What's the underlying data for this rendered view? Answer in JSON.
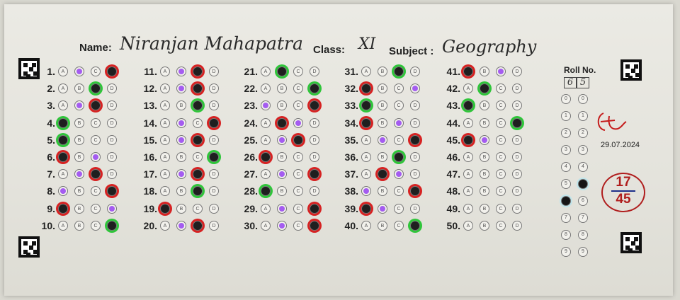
{
  "header": {
    "name_label": "Name:",
    "name_value": "Niranjan Mahapatra",
    "class_label": "Class:",
    "class_value": "XI",
    "subject_label": "Subject :",
    "subject_value": "Geography"
  },
  "roll": {
    "label": "Roll No.",
    "digits": [
      "6",
      "5"
    ]
  },
  "date": "29.07.2024",
  "score": {
    "obtained": "17",
    "total": "45"
  },
  "colors": {
    "wrong": "#d62222",
    "correct": "#2fc53a",
    "marked": "#a45cf0",
    "filled": "#1f1f1f"
  },
  "questions": [
    {
      "n": "1.",
      "m": "B",
      "f": "D",
      "c": "red"
    },
    {
      "n": "2.",
      "m": "",
      "f": "C",
      "c": "green"
    },
    {
      "n": "3.",
      "m": "B",
      "f": "C",
      "c": "red"
    },
    {
      "n": "4.",
      "m": "",
      "f": "A",
      "c": "green"
    },
    {
      "n": "5.",
      "m": "",
      "f": "A",
      "c": "green"
    },
    {
      "n": "6.",
      "m": "C",
      "f": "A",
      "c": "red"
    },
    {
      "n": "7.",
      "m": "B",
      "f": "C",
      "c": "red"
    },
    {
      "n": "8.",
      "m": "A",
      "f": "D",
      "c": "red"
    },
    {
      "n": "9.",
      "m": "D",
      "f": "A",
      "c": "red"
    },
    {
      "n": "10.",
      "m": "",
      "f": "D",
      "c": "green"
    },
    {
      "n": "11.",
      "m": "B",
      "f": "C",
      "c": "red"
    },
    {
      "n": "12.",
      "m": "B",
      "f": "C",
      "c": "red"
    },
    {
      "n": "13.",
      "m": "",
      "f": "C",
      "c": "green"
    },
    {
      "n": "14.",
      "m": "B",
      "f": "D",
      "c": "red"
    },
    {
      "n": "15.",
      "m": "B",
      "f": "C",
      "c": "red"
    },
    {
      "n": "16.",
      "m": "",
      "f": "D",
      "c": "green"
    },
    {
      "n": "17.",
      "m": "B",
      "f": "C",
      "c": "red"
    },
    {
      "n": "18.",
      "m": "",
      "f": "C",
      "c": "green"
    },
    {
      "n": "19.",
      "m": "",
      "f": "A",
      "c": "red"
    },
    {
      "n": "20.",
      "m": "B",
      "f": "C",
      "c": "red"
    },
    {
      "n": "21.",
      "m": "",
      "f": "B",
      "c": "green"
    },
    {
      "n": "22.",
      "m": "",
      "f": "D",
      "c": "green"
    },
    {
      "n": "23.",
      "m": "A",
      "f": "D",
      "c": "red"
    },
    {
      "n": "24.",
      "m": "C",
      "f": "B",
      "c": "red"
    },
    {
      "n": "25.",
      "m": "B",
      "f": "C",
      "c": "red"
    },
    {
      "n": "26.",
      "m": "",
      "f": "A",
      "c": "red"
    },
    {
      "n": "27.",
      "m": "B",
      "f": "D",
      "c": "red"
    },
    {
      "n": "28.",
      "m": "",
      "f": "A",
      "c": "green"
    },
    {
      "n": "29.",
      "m": "B",
      "f": "D",
      "c": "red"
    },
    {
      "n": "30.",
      "m": "B",
      "f": "D",
      "c": "red"
    },
    {
      "n": "31.",
      "m": "",
      "f": "C",
      "c": "green"
    },
    {
      "n": "32.",
      "m": "D",
      "f": "A",
      "c": "red"
    },
    {
      "n": "33.",
      "m": "",
      "f": "A",
      "c": "green"
    },
    {
      "n": "34.",
      "m": "C",
      "f": "A",
      "c": "red"
    },
    {
      "n": "35.",
      "m": "B",
      "f": "D",
      "c": "red"
    },
    {
      "n": "36.",
      "m": "",
      "f": "C",
      "c": "green"
    },
    {
      "n": "37.",
      "m": "C",
      "f": "B",
      "c": "red"
    },
    {
      "n": "38.",
      "m": "A",
      "f": "D",
      "c": "red"
    },
    {
      "n": "39.",
      "m": "B",
      "f": "A",
      "c": "red"
    },
    {
      "n": "40.",
      "m": "",
      "f": "D",
      "c": "green"
    },
    {
      "n": "41.",
      "m": "C",
      "f": "A",
      "c": "red"
    },
    {
      "n": "42.",
      "m": "",
      "f": "B",
      "c": "green"
    },
    {
      "n": "43.",
      "m": "",
      "f": "A",
      "c": "green"
    },
    {
      "n": "44.",
      "m": "",
      "f": "D",
      "c": "green"
    },
    {
      "n": "45.",
      "m": "B",
      "f": "A",
      "c": "red"
    },
    {
      "n": "46.",
      "m": "",
      "f": "",
      "c": ""
    },
    {
      "n": "47.",
      "m": "",
      "f": "",
      "c": ""
    },
    {
      "n": "48.",
      "m": "",
      "f": "",
      "c": ""
    },
    {
      "n": "49.",
      "m": "",
      "f": "",
      "c": ""
    },
    {
      "n": "50.",
      "m": "",
      "f": "",
      "c": ""
    }
  ]
}
